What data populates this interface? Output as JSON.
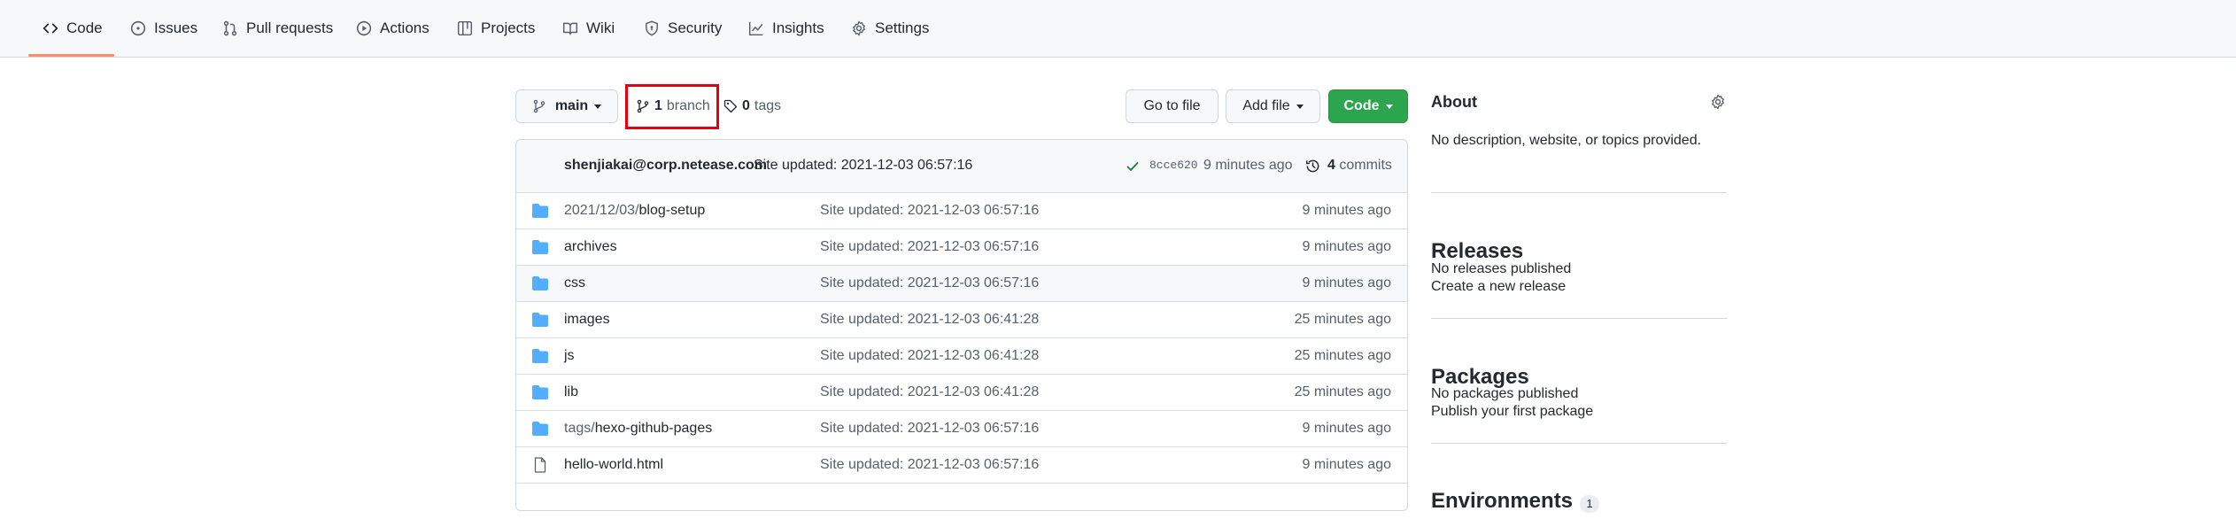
{
  "nav": {
    "tabs": [
      {
        "label": "Code",
        "icon": "code-icon"
      },
      {
        "label": "Issues",
        "icon": "issue-opened-icon"
      },
      {
        "label": "Pull requests",
        "icon": "git-pull-request-icon"
      },
      {
        "label": "Actions",
        "icon": "play-icon"
      },
      {
        "label": "Projects",
        "icon": "table-icon"
      },
      {
        "label": "Wiki",
        "icon": "book-icon"
      },
      {
        "label": "Security",
        "icon": "shield-icon"
      },
      {
        "label": "Insights",
        "icon": "graph-icon"
      },
      {
        "label": "Settings",
        "icon": "gear-icon"
      }
    ],
    "selected_tab": "Code",
    "underline_color": "#fd8c73"
  },
  "branch_bar": {
    "branch_name": "main",
    "branch_count": "1",
    "branch_word": "branch",
    "tag_count": "0",
    "tag_word": "tags",
    "go_to_file": "Go to file",
    "add_file": "Add file",
    "code_button": "Code",
    "code_button_color": "#2da44e"
  },
  "latest_commit": {
    "author": "shenjiakai@corp.netease.com",
    "message": "Site updated: 2021-12-03 06:57:16",
    "sha": "8cce620",
    "time_ago": "9 minutes ago",
    "commit_count": "4",
    "commit_word": "commits",
    "status": "success"
  },
  "files": [
    {
      "type": "folder",
      "name_prefix": "2021/12/03/",
      "name": "blog-setup",
      "message": "Site updated: 2021-12-03 06:57:16",
      "age": "9 minutes ago"
    },
    {
      "type": "folder",
      "name_prefix": "",
      "name": "archives",
      "message": "Site updated: 2021-12-03 06:57:16",
      "age": "9 minutes ago"
    },
    {
      "type": "folder",
      "name_prefix": "",
      "name": "css",
      "message": "Site updated: 2021-12-03 06:57:16",
      "age": "9 minutes ago"
    },
    {
      "type": "folder",
      "name_prefix": "",
      "name": "images",
      "message": "Site updated: 2021-12-03 06:41:28",
      "age": "25 minutes ago"
    },
    {
      "type": "folder",
      "name_prefix": "",
      "name": "js",
      "message": "Site updated: 2021-12-03 06:41:28",
      "age": "25 minutes ago"
    },
    {
      "type": "folder",
      "name_prefix": "",
      "name": "lib",
      "message": "Site updated: 2021-12-03 06:41:28",
      "age": "25 minutes ago"
    },
    {
      "type": "folder",
      "name_prefix": "tags/",
      "name": "hexo-github-pages",
      "message": "Site updated: 2021-12-03 06:57:16",
      "age": "9 minutes ago"
    },
    {
      "type": "file",
      "name_prefix": "",
      "name": "hello-world.html",
      "message": "Site updated: 2021-12-03 06:57:16",
      "age": "9 minutes ago"
    }
  ],
  "sidebar": {
    "about_title": "About",
    "about_desc": "No description, website, or topics provided.",
    "releases_title": "Releases",
    "releases_none": "No releases published",
    "releases_link": "Create a new release",
    "packages_title": "Packages",
    "packages_none": "No packages published",
    "packages_link": "Publish your first package",
    "environments_title": "Environments",
    "environments_count": "1"
  },
  "colors": {
    "folder": "#54aeff",
    "link": "#0969da",
    "success": "#1a7f37",
    "highlight": "#e3000f"
  }
}
